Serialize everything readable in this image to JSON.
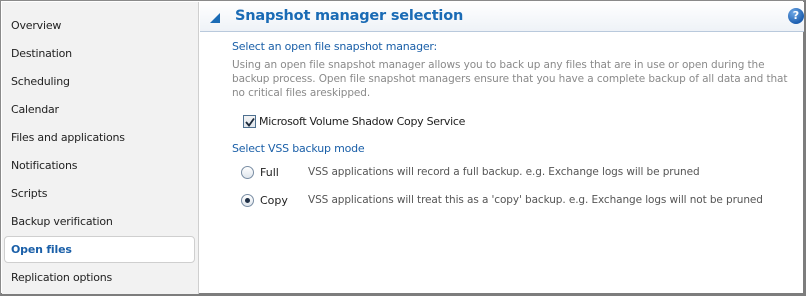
{
  "sidebar": {
    "items": [
      {
        "label": "Overview",
        "selected": false
      },
      {
        "label": "Destination",
        "selected": false
      },
      {
        "label": "Scheduling",
        "selected": false
      },
      {
        "label": "Calendar",
        "selected": false
      },
      {
        "label": "Files and applications",
        "selected": false
      },
      {
        "label": "Notifications",
        "selected": false
      },
      {
        "label": "Scripts",
        "selected": false
      },
      {
        "label": "Backup verification",
        "selected": false
      },
      {
        "label": "Open files",
        "selected": true
      },
      {
        "label": "Replication options",
        "selected": false
      }
    ]
  },
  "section": {
    "title": "Snapshot manager selection",
    "collapse_icon": "triangle-up-icon",
    "help_icon": "question-mark-icon",
    "help_glyph": "?"
  },
  "snapshot": {
    "prompt": "Select an open file snapshot manager:",
    "description": "Using an open file snapshot manager allows you to back up any files that are in use or open during the backup process.  Open file snapshot managers ensure that you have a complete backup of all data and that no critical files areskipped.",
    "vss_checkbox": {
      "label": "Microsoft Volume Shadow Copy Service",
      "checked": true
    }
  },
  "vss_mode": {
    "prompt": "Select VSS backup mode",
    "options": [
      {
        "label": "Full",
        "description": "VSS applications will record a full backup. e.g. Exchange logs will be pruned",
        "checked": false
      },
      {
        "label": "Copy",
        "description": "VSS applications will treat this as a 'copy' backup. e.g. Exchange logs will not be pruned",
        "checked": true
      }
    ]
  },
  "colors": {
    "accent": "#1a6bb5",
    "selected_text": "#1a5fa8",
    "sidebar_bg": "#f2f2f2",
    "muted_text": "#8a8a8a"
  }
}
